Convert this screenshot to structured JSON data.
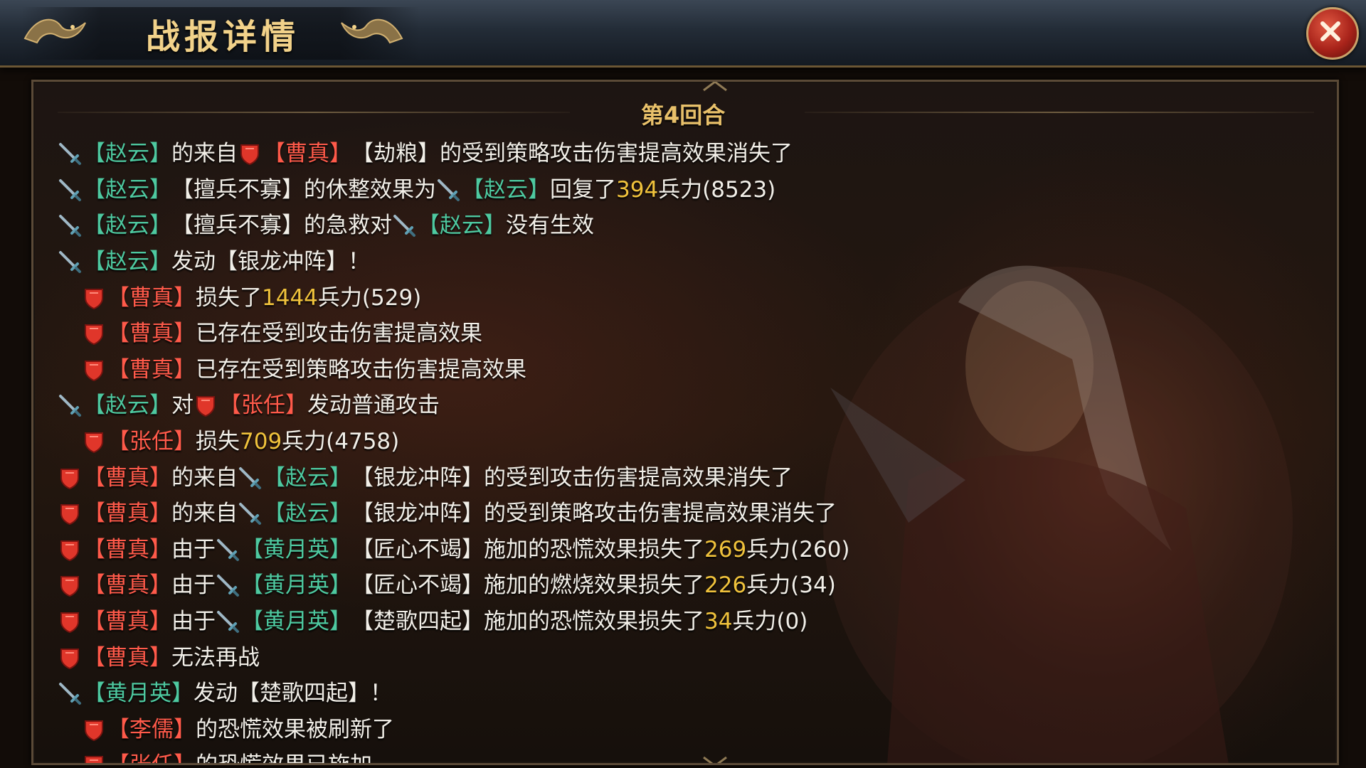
{
  "header": {
    "title": "战报详情",
    "close_label": "X"
  },
  "round": {
    "label": "第4回合"
  },
  "colors": {
    "ally": "#4ec9a0",
    "enemy": "#ff5a4a",
    "number": "#f0c23c",
    "text": "#f2efe8"
  },
  "icons": {
    "ally": "sword-icon",
    "enemy": "shield-icon"
  },
  "log": [
    {
      "indent": false,
      "segments": [
        {
          "icon": "ally"
        },
        {
          "t": "【赵云】",
          "c": "green"
        },
        {
          "t": "的来自",
          "c": "white"
        },
        {
          "icon": "enemy"
        },
        {
          "t": "【曹真】",
          "c": "red"
        },
        {
          "t": "【劫粮】的受到策略攻击伤害提高效果消失了",
          "c": "white"
        }
      ]
    },
    {
      "indent": false,
      "segments": [
        {
          "icon": "ally"
        },
        {
          "t": "【赵云】",
          "c": "green"
        },
        {
          "t": "【擅兵不寡】的休整效果为",
          "c": "white"
        },
        {
          "icon": "ally"
        },
        {
          "t": "【赵云】",
          "c": "green"
        },
        {
          "t": "回复了",
          "c": "white"
        },
        {
          "t": "394",
          "c": "yellow"
        },
        {
          "t": "兵力(8523)",
          "c": "white"
        }
      ]
    },
    {
      "indent": false,
      "segments": [
        {
          "icon": "ally"
        },
        {
          "t": "【赵云】",
          "c": "green"
        },
        {
          "t": "【擅兵不寡】的急救对",
          "c": "white"
        },
        {
          "icon": "ally"
        },
        {
          "t": "【赵云】",
          "c": "green"
        },
        {
          "t": "没有生效",
          "c": "white"
        }
      ]
    },
    {
      "indent": false,
      "segments": [
        {
          "icon": "ally"
        },
        {
          "t": "【赵云】",
          "c": "green"
        },
        {
          "t": "发动【银龙冲阵】！",
          "c": "white"
        }
      ]
    },
    {
      "indent": true,
      "segments": [
        {
          "icon": "enemy"
        },
        {
          "t": "【曹真】",
          "c": "red"
        },
        {
          "t": "损失了",
          "c": "white"
        },
        {
          "t": "1444",
          "c": "yellow"
        },
        {
          "t": "兵力(529)",
          "c": "white"
        }
      ]
    },
    {
      "indent": true,
      "segments": [
        {
          "icon": "enemy"
        },
        {
          "t": "【曹真】",
          "c": "red"
        },
        {
          "t": "已存在受到攻击伤害提高效果",
          "c": "white"
        }
      ]
    },
    {
      "indent": true,
      "segments": [
        {
          "icon": "enemy"
        },
        {
          "t": "【曹真】",
          "c": "red"
        },
        {
          "t": "已存在受到策略攻击伤害提高效果",
          "c": "white"
        }
      ]
    },
    {
      "indent": false,
      "segments": [
        {
          "icon": "ally"
        },
        {
          "t": "【赵云】",
          "c": "green"
        },
        {
          "t": "对",
          "c": "white"
        },
        {
          "icon": "enemy"
        },
        {
          "t": "【张任】",
          "c": "red"
        },
        {
          "t": "发动普通攻击",
          "c": "white"
        }
      ]
    },
    {
      "indent": true,
      "segments": [
        {
          "icon": "enemy"
        },
        {
          "t": "【张任】",
          "c": "red"
        },
        {
          "t": "损失",
          "c": "white"
        },
        {
          "t": "709",
          "c": "yellow"
        },
        {
          "t": "兵力(4758)",
          "c": "white"
        }
      ]
    },
    {
      "indent": false,
      "segments": [
        {
          "icon": "enemy"
        },
        {
          "t": "【曹真】",
          "c": "red"
        },
        {
          "t": "的来自",
          "c": "white"
        },
        {
          "icon": "ally"
        },
        {
          "t": "【赵云】",
          "c": "green"
        },
        {
          "t": "【银龙冲阵】的受到攻击伤害提高效果消失了",
          "c": "white"
        }
      ]
    },
    {
      "indent": false,
      "segments": [
        {
          "icon": "enemy"
        },
        {
          "t": "【曹真】",
          "c": "red"
        },
        {
          "t": "的来自",
          "c": "white"
        },
        {
          "icon": "ally"
        },
        {
          "t": "【赵云】",
          "c": "green"
        },
        {
          "t": "【银龙冲阵】的受到策略攻击伤害提高效果消失了",
          "c": "white"
        }
      ]
    },
    {
      "indent": false,
      "segments": [
        {
          "icon": "enemy"
        },
        {
          "t": "【曹真】",
          "c": "red"
        },
        {
          "t": "由于",
          "c": "white"
        },
        {
          "icon": "ally"
        },
        {
          "t": "【黄月英】",
          "c": "green"
        },
        {
          "t": "【匠心不竭】施加的恐慌效果损失了",
          "c": "white"
        },
        {
          "t": "269",
          "c": "yellow"
        },
        {
          "t": "兵力(260)",
          "c": "white"
        }
      ]
    },
    {
      "indent": false,
      "segments": [
        {
          "icon": "enemy"
        },
        {
          "t": "【曹真】",
          "c": "red"
        },
        {
          "t": "由于",
          "c": "white"
        },
        {
          "icon": "ally"
        },
        {
          "t": "【黄月英】",
          "c": "green"
        },
        {
          "t": "【匠心不竭】施加的燃烧效果损失了",
          "c": "white"
        },
        {
          "t": "226",
          "c": "yellow"
        },
        {
          "t": "兵力(34)",
          "c": "white"
        }
      ]
    },
    {
      "indent": false,
      "segments": [
        {
          "icon": "enemy"
        },
        {
          "t": "【曹真】",
          "c": "red"
        },
        {
          "t": "由于",
          "c": "white"
        },
        {
          "icon": "ally"
        },
        {
          "t": "【黄月英】",
          "c": "green"
        },
        {
          "t": "【楚歌四起】施加的恐慌效果损失了",
          "c": "white"
        },
        {
          "t": "34",
          "c": "yellow"
        },
        {
          "t": "兵力(0)",
          "c": "white"
        }
      ]
    },
    {
      "indent": false,
      "segments": [
        {
          "icon": "enemy"
        },
        {
          "t": "【曹真】",
          "c": "red"
        },
        {
          "t": "无法再战",
          "c": "white"
        }
      ]
    },
    {
      "indent": false,
      "segments": [
        {
          "icon": "ally"
        },
        {
          "t": "【黄月英】",
          "c": "green"
        },
        {
          "t": "发动【楚歌四起】！",
          "c": "white"
        }
      ]
    },
    {
      "indent": true,
      "segments": [
        {
          "icon": "enemy"
        },
        {
          "t": "【李儒】",
          "c": "red"
        },
        {
          "t": "的恐慌效果被刷新了",
          "c": "white"
        }
      ]
    },
    {
      "indent": true,
      "segments": [
        {
          "icon": "enemy"
        },
        {
          "t": "【张任】",
          "c": "red"
        },
        {
          "t": "的恐慌效果已施加",
          "c": "white"
        }
      ]
    }
  ]
}
